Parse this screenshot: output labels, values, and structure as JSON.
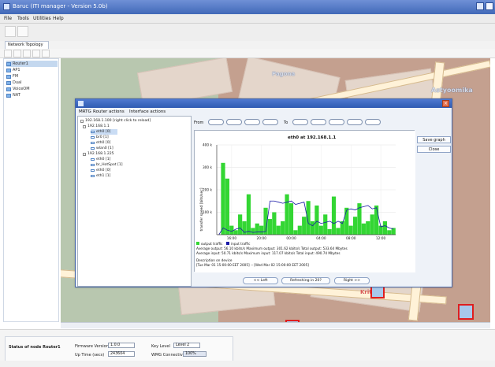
{
  "app": {
    "title": "Baruc (ITI manager - Version 5.0b)",
    "menus": [
      "File",
      "Tools",
      "Utilities",
      "Help"
    ],
    "tab": "Network Topology"
  },
  "sidebar": {
    "items": [
      "Router1",
      "AP1",
      "FM",
      "Dual",
      "VoiceOM",
      "NAT"
    ]
  },
  "map": {
    "labels": [
      "Pagona",
      "Astyoomika",
      "Kritika"
    ]
  },
  "dialog": {
    "menus": [
      "MRTG",
      "Router actions",
      "Interface actions"
    ],
    "tree": [
      "192.168.1.100 [right click to reload]",
      "192.168.1.1",
      "eth0 [0]",
      "br0 [1]",
      "eth0 [0]",
      "wlan0 [1]",
      "192.168.1.225",
      "eth0 [1]",
      "br_HotSpot [1]",
      "eth0 [0]",
      "eth1 [1]"
    ],
    "from_label": "From",
    "to_label": "To",
    "buttons": {
      "save_graph": "Save graph",
      "close": "Close",
      "left": "<< Left",
      "refresh": "Refreshing in 20?",
      "right": "Right >>"
    }
  },
  "chart_data": {
    "type": "area",
    "title": "eth0 at 192.168.1.1",
    "xlabel": "",
    "ylabel": "transfer speed [bits/sec]",
    "x_ticks": [
      "16:00",
      "20:00",
      "00:00",
      "04:00",
      "08:00",
      "12:00"
    ],
    "y_ticks": [
      "100 k",
      "200 k",
      "300 k",
      "400 k"
    ],
    "ylim": [
      0,
      400000
    ],
    "series": [
      {
        "name": "output traffic",
        "color": "#33d633",
        "values": [
          0,
          320000,
          250000,
          40000,
          20000,
          90000,
          60000,
          180000,
          30000,
          50000,
          40000,
          120000,
          70000,
          100000,
          40000,
          60000,
          180000,
          140000,
          20000,
          40000,
          80000,
          150000,
          60000,
          130000,
          40000,
          90000,
          25000,
          170000,
          30000,
          60000,
          120000,
          40000,
          80000,
          140000,
          50000,
          60000,
          90000,
          130000,
          40000,
          60000,
          20000,
          30000
        ]
      },
      {
        "name": "input traffic",
        "color": "#1b1ba8",
        "values": [
          0,
          30000,
          20000,
          15000,
          25000,
          30000,
          10000,
          15000,
          10000,
          12000,
          12000,
          14000,
          150000,
          150000,
          145000,
          140000,
          145000,
          150000,
          135000,
          140000,
          145000,
          50000,
          40000,
          60000,
          50000,
          55000,
          60000,
          50000,
          60000,
          50000,
          110000,
          115000,
          110000,
          120000,
          125000,
          130000,
          115000,
          120000,
          35000,
          40000,
          30000,
          25000
        ]
      }
    ],
    "legend": [
      "output traffic",
      "input traffic"
    ],
    "stats": [
      "Average output: 56.10 kbits/s  Maximum output: 301.62 kbits/s  Total output: 533.64 Mbytes",
      "Average input:  50.71 kbits/s  Maximum input:  117.07 kbits/s  Total input:  490.74 Mbytes"
    ],
    "description_label": "Description on device",
    "time_range": "[Tue Mar 01 15:00:00 EET 2005] -- [Wed Mar 02 15:00:00 EET 2005]"
  },
  "status": {
    "node_label": "Status of node Router1",
    "firmware_label": "Firmware Version",
    "firmware_value": "1.0.0",
    "uptime_label": "Up Time (secs)",
    "uptime_value": "243604",
    "key_level_label": "Key Level",
    "key_level_value": "Level 2",
    "wmg_label": "WMG Connectivity",
    "wmg_value": "100%"
  }
}
